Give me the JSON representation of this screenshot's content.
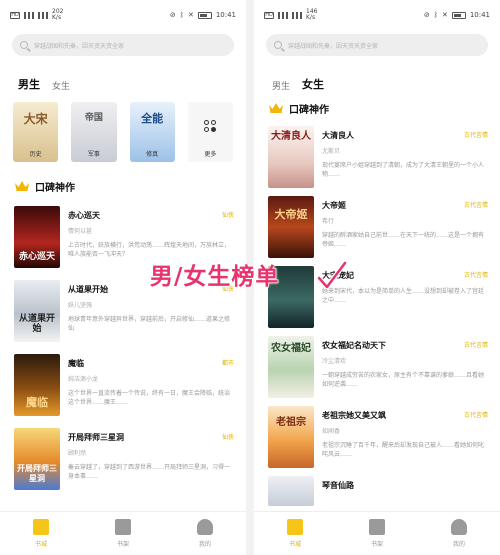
{
  "status_left": {
    "speed_value": "202",
    "speed_unit": "K/s"
  },
  "status_right": {
    "speed_value": "146",
    "speed_unit": "K/s"
  },
  "time": "10:41",
  "search": {
    "placeholder": "穿越战国和先秦，因天资天资全家"
  },
  "left": {
    "tabs": [
      {
        "label": "男生"
      },
      {
        "label": "女生"
      }
    ],
    "categories": [
      {
        "label": "历史",
        "art": "大宋"
      },
      {
        "label": "军事",
        "art": "帝国"
      },
      {
        "label": "修真",
        "art": "全能"
      },
      {
        "label": "更多"
      }
    ],
    "section_title": "口碑神作",
    "books": [
      {
        "title": "赤心巡天",
        "author": "情何以甚",
        "desc": "上古时代，妖族横行，洪荒动荡……辉煌天地间，万族林立，唯人族能否一飞冲天？",
        "tag": "仙侠",
        "cover_text": "赤心巡天"
      },
      {
        "title": "从道果开始",
        "author": "妖儿坚强",
        "desc": "地球青年意外穿越异世界，穿越前后，开启修仙……道果之修仙",
        "tag": "仙侠",
        "cover_text": "从道果开始"
      },
      {
        "title": "魔临",
        "author": "纯洁滴小龙",
        "desc": "这个世界一直流传着一个传说，终有一日，魔王会降临，统治这个世界……魔王……",
        "tag": "都市",
        "cover_text": "魔临"
      },
      {
        "title": "开局拜师三星洞",
        "author": "顾利然",
        "desc": "秦云穿越了，穿越到了西游世界……开局拜师三星洞，习得一身本事……",
        "tag": "仙侠",
        "cover_text": "开局拜师三星洞"
      }
    ]
  },
  "right": {
    "tabs": [
      {
        "label": "男生"
      },
      {
        "label": "女生"
      }
    ],
    "section_title": "口碑神作",
    "books": [
      {
        "title": "大清良人",
        "author": "尤斯贝",
        "desc": "现代宴席户小姐穿越到了清朝，成为了大清王朝里的一个小人物……",
        "tag": "古代言情",
        "cover_text": "大清良人"
      },
      {
        "title": "大帝姬",
        "author": "希行",
        "desc": "穿越的醉酒家姑自己前世……在天下一统的……这是一个拥有帝姬……",
        "tag": "古代言情",
        "cover_text": "大帝姬"
      },
      {
        "title": "大宋宠妃",
        "author": "",
        "desc": "她来到宋代，本以为是简单的人生……没想到却被卷入了宫廷之中……",
        "tag": "古代言情",
        "cover_text": ""
      },
      {
        "title": "农女福妃名动天下",
        "author": "冷尘清欢",
        "desc": "一朝穿越成穷苦的农家女，原主有个不靠谱的爹娘……且看她如何逆袭……",
        "tag": "古代言情",
        "cover_text": "农女福妃"
      },
      {
        "title": "老祖宗她又美又飒",
        "author": "如闻香",
        "desc": "老祖宗沉睡了百千年，醒来后却发现自己被人……看她如何叱咤风云……",
        "tag": "古代言情",
        "cover_text": "老祖宗"
      },
      {
        "title": "琴音仙路",
        "author": "",
        "desc": "",
        "tag": "",
        "cover_text": ""
      }
    ]
  },
  "overlay": {
    "text": "男/女生榜单"
  },
  "bottom_nav": [
    {
      "label": "书城"
    },
    {
      "label": "书架"
    },
    {
      "label": "我的"
    }
  ]
}
